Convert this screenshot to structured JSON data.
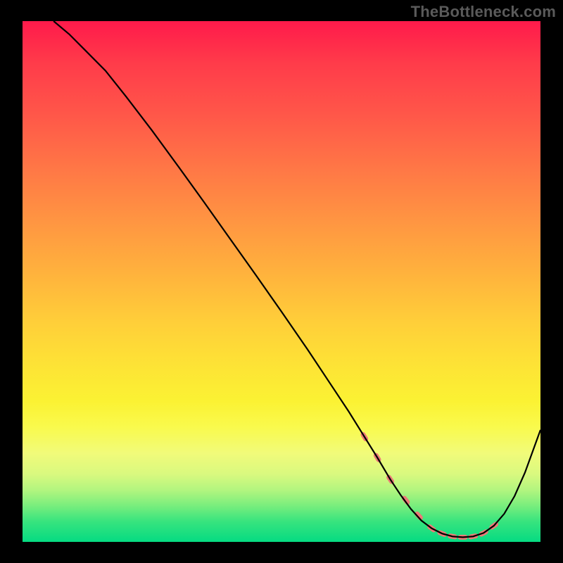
{
  "watermark": "TheBottleneck.com",
  "chart_data": {
    "type": "line",
    "title": "",
    "xlabel": "",
    "ylabel": "",
    "xlim": [
      0,
      100
    ],
    "ylim": [
      0,
      100
    ],
    "grid": false,
    "legend": false,
    "series": [
      {
        "name": "curve",
        "x": [
          6,
          9,
          12,
          16,
          20,
          25,
          30,
          35,
          40,
          45,
          50,
          55,
          60,
          63,
          66,
          68.5,
          71,
          73,
          75,
          77,
          79,
          81,
          83,
          85,
          87,
          89,
          91,
          93,
          95,
          97,
          100
        ],
        "y": [
          100,
          97.5,
          94.5,
          90.5,
          85.5,
          79,
          72.2,
          65.3,
          58.3,
          51.3,
          44.2,
          37,
          29.5,
          25,
          20.2,
          16.2,
          12,
          9,
          6.3,
          4.1,
          2.6,
          1.6,
          1.05,
          0.9,
          1.05,
          1.7,
          3.1,
          5.4,
          8.8,
          13.3,
          21.5
        ]
      }
    ],
    "dotted_region": {
      "x": [
        66,
        68.5,
        71,
        74,
        76.5,
        79,
        81,
        83,
        85,
        87,
        89,
        91
      ],
      "y": [
        20.2,
        16.2,
        12,
        8,
        5,
        2.6,
        1.6,
        1.05,
        0.9,
        1.05,
        1.7,
        3.1
      ]
    },
    "dot_color": "#eb7a77",
    "line_color": "#000000"
  }
}
